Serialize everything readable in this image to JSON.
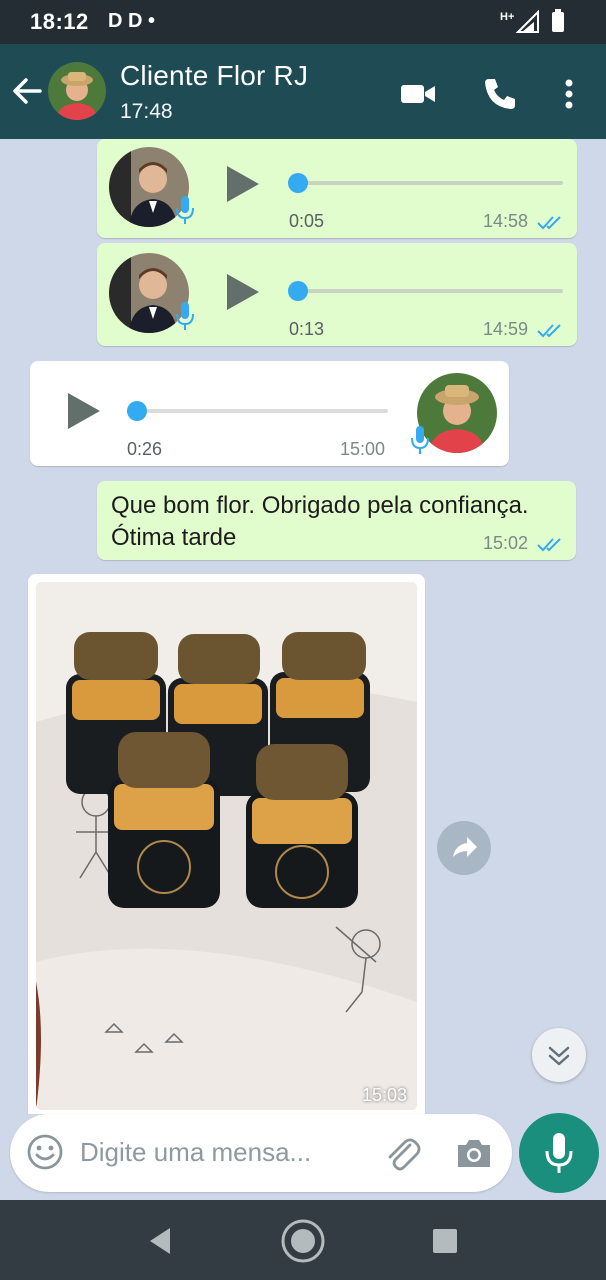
{
  "status_bar": {
    "time": "18:12",
    "left_icons": "D D •",
    "network": "H+"
  },
  "header": {
    "contact_name": "Cliente Flor RJ",
    "last_seen": "17:48"
  },
  "messages": [
    {
      "type": "voice",
      "direction": "out",
      "duration": "0:05",
      "time": "14:58",
      "progress": 0
    },
    {
      "type": "voice",
      "direction": "out",
      "duration": "0:13",
      "time": "14:59",
      "progress": 0
    },
    {
      "type": "voice",
      "direction": "in",
      "duration": "0:26",
      "time": "15:00",
      "progress": 0
    },
    {
      "type": "text",
      "direction": "out",
      "text": "Que bom flor. Obrigado pela confiança. Ótima tarde",
      "time": "15:02"
    },
    {
      "type": "image",
      "direction": "in",
      "time": "15:03"
    }
  ],
  "composer": {
    "placeholder": "Digite uma mensa..."
  },
  "colors": {
    "app_bar": "#1f4b55",
    "outgoing_bubble": "#e1fccd",
    "read_ticks": "#34aaf0",
    "mic_button": "#1a8f7d"
  }
}
